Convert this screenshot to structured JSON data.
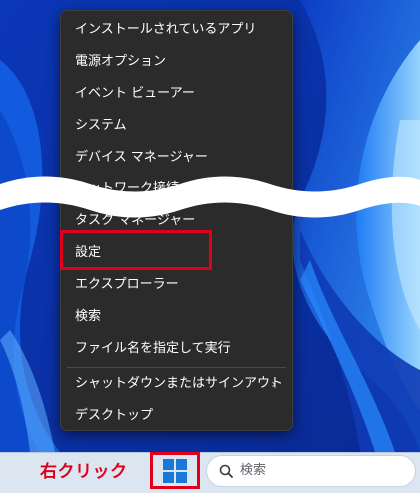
{
  "menu": {
    "items": [
      {
        "label": "インストールされているアプリ"
      },
      {
        "label": "電源オプション"
      },
      {
        "label": "イベント ビューアー"
      },
      {
        "label": "システム"
      },
      {
        "label": "デバイス マネージャー"
      },
      {
        "label": "ネットワーク接続"
      },
      {
        "label": "タスク マネージャー"
      },
      {
        "label": "設定"
      },
      {
        "label": "エクスプローラー"
      },
      {
        "label": "検索"
      },
      {
        "label": "ファイル名を指定して実行"
      },
      {
        "label": "シャットダウンまたはサインアウト",
        "submenu_icon": "chevron-right-icon"
      },
      {
        "label": "デスクトップ"
      }
    ]
  },
  "annotation": {
    "right_click_label": "右クリック",
    "highlight_color": "#e0001b"
  },
  "taskbar": {
    "start_icon": "windows-logo-icon",
    "search_placeholder": "検索",
    "search_icon": "search-icon"
  },
  "colors": {
    "menu_bg": "#2b2b2b",
    "menu_text": "#ffffff",
    "taskbar_bg": "#dce6f1",
    "accent": "#1a78d6"
  }
}
